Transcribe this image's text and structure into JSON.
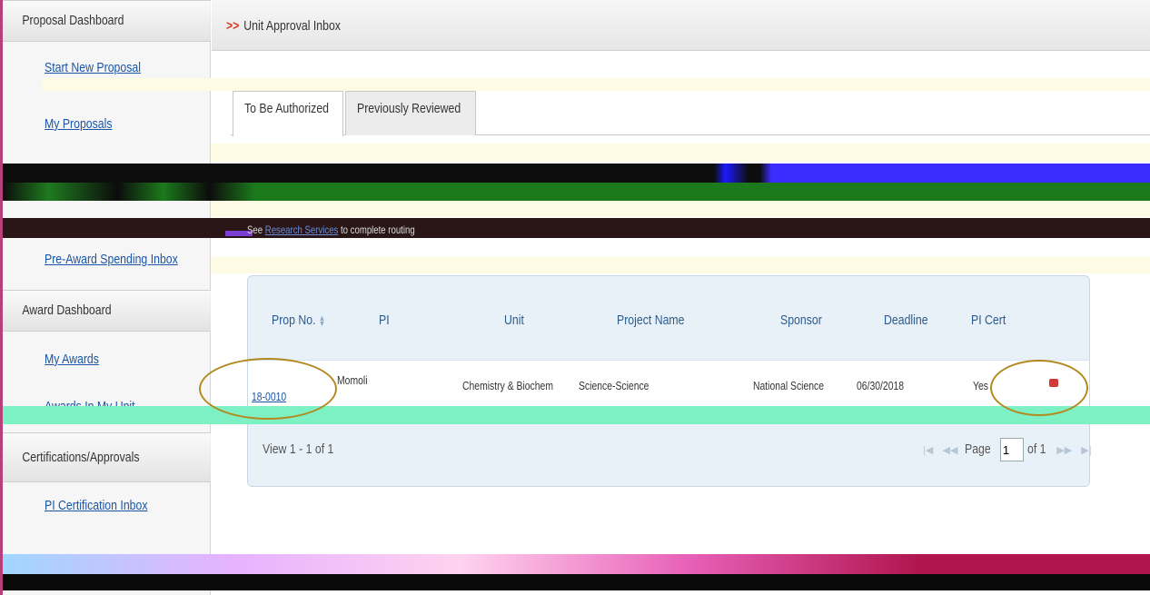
{
  "sidebar": {
    "proposal_header": "Proposal Dashboard",
    "start_new_proposal": "Start New Proposal",
    "my_proposals": "My Proposals",
    "pre_award_inbox": "Pre-Award Spending Inbox",
    "award_header": "Award Dashboard",
    "my_awards": "My Awards",
    "awards_in_my_unit": "Awards In My Unit",
    "cert_header": "Certifications/Approvals",
    "pi_cert_inbox": "PI Certification Inbox"
  },
  "breadcrumb": {
    "arrows": ">>",
    "title": "Unit Approval Inbox"
  },
  "tabs": [
    {
      "label": "To Be Authorized",
      "active": true
    },
    {
      "label": "Previously Reviewed",
      "active": false
    }
  ],
  "notice": {
    "prefix": "See",
    "link": "Research Services",
    "suffix": "to complete routing"
  },
  "table": {
    "columns": [
      "Prop No.",
      "PI",
      "Unit",
      "Project Name",
      "Sponsor",
      "Deadline",
      "PI Cert"
    ],
    "rows": [
      {
        "prop_no": "18-0010",
        "pi": "Momoli",
        "unit": "Chemistry & Biochem",
        "project_name": "Science-Science",
        "sponsor": "National Science",
        "deadline": "06/30/2018",
        "pi_cert": "Yes",
        "action_icon": "pdf-icon"
      }
    ],
    "footer": "View 1 - 1 of 1",
    "pager": {
      "page_label": "Page",
      "page_value": "1",
      "of_label": "of 1"
    }
  },
  "colors": {
    "link": "#1a55a6",
    "header_text": "#2a5b8c",
    "panel_bg": "#e9f1f8",
    "highlight_ring": "#b38a1f",
    "accent_arrow": "#d43a1f"
  }
}
